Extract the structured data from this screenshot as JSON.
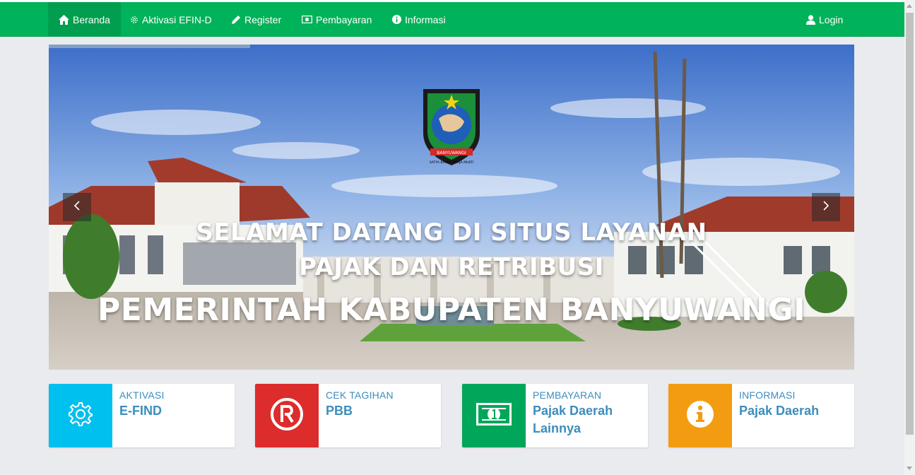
{
  "nav": {
    "home": "Beranda",
    "activation": "Aktivasi EFIN-D",
    "register": "Register",
    "payment": "Pembayaran",
    "info": "Informasi",
    "login": "Login"
  },
  "hero": {
    "line1": "SELAMAT DATANG DI SITUS LAYANAN",
    "line2": "PAJAK DAN RETRIBUSI",
    "line3": "PEMERINTAH KABUPATEN BANYUWANGI",
    "emblem_banner": "BANYUWANGI",
    "emblem_motto": "SATYA BHAKTI PRAJA MUKTI",
    "slide_progress": 0.25
  },
  "cards": [
    {
      "caption": "AKTIVASI",
      "title": "E-FIND",
      "color": "#00c0ef",
      "icon": "gear-icon"
    },
    {
      "caption": "CEK TAGIHAN",
      "title": "PBB",
      "color": "#dd2c2c",
      "icon": "registered-icon"
    },
    {
      "caption": "PEMBAYARAN",
      "title": "Pajak Daerah Lainnya",
      "color": "#00a65a",
      "icon": "money-icon"
    },
    {
      "caption": "INFORMASI",
      "title": "Pajak Daerah",
      "color": "#f39c12",
      "icon": "info-icon"
    }
  ],
  "colors": {
    "navbar": "#00b259",
    "navbar_active": "#009e4e",
    "card_text": "#3c8dbc"
  }
}
